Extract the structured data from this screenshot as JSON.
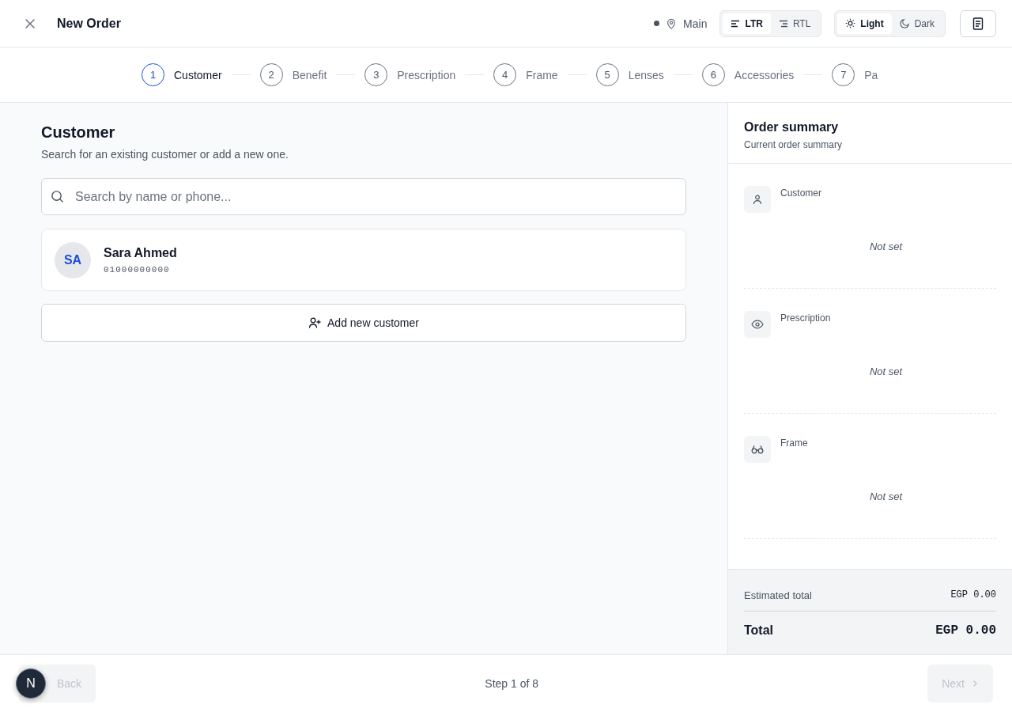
{
  "header": {
    "title": "New Order",
    "location": "Main",
    "direction": [
      {
        "label": "LTR",
        "kind": "ltr",
        "selected": true
      },
      {
        "label": "RTL",
        "kind": "rtl",
        "selected": false
      }
    ],
    "theme": [
      {
        "label": "Light",
        "kind": "light",
        "selected": true
      },
      {
        "label": "Dark",
        "kind": "dark",
        "selected": false
      }
    ]
  },
  "steps": [
    {
      "number": "1",
      "label": "Customer",
      "selected": true
    },
    {
      "number": "2",
      "label": "Benefit",
      "selected": false
    },
    {
      "number": "3",
      "label": "Prescription",
      "selected": false
    },
    {
      "number": "4",
      "label": "Frame",
      "selected": false
    },
    {
      "number": "5",
      "label": "Lenses",
      "selected": false
    },
    {
      "number": "6",
      "label": "Accessories",
      "selected": false
    },
    {
      "number": "7",
      "label": "Pa",
      "selected": false
    }
  ],
  "customer_section": {
    "title": "Customer",
    "subtitle": "Search for an existing customer or add a new one.",
    "search": {
      "placeholder": "Search by name or phone..."
    },
    "customers": [
      {
        "initials": "SA",
        "name": "Sara Ahmed",
        "phone": "01000000000"
      }
    ],
    "add_button": "Add new customer"
  },
  "summary": {
    "title": "Order summary",
    "subtitle": "Current order summary",
    "items": [
      {
        "kind": "person",
        "label": "Customer",
        "value": "Not set"
      },
      {
        "kind": "eye",
        "label": "Prescription",
        "value": "Not set"
      },
      {
        "kind": "glasses",
        "label": "Frame",
        "value": "Not set"
      }
    ],
    "estimated_label": "Estimated total",
    "estimated_value": "EGP 0.00",
    "total_label": "Total",
    "total_value": "EGP 0.00"
  },
  "footer": {
    "back": {
      "label": "Back",
      "disabled": true
    },
    "step_text": "Step 1 of 8",
    "next": {
      "label": "Next",
      "disabled": true
    },
    "dev_badge": "N"
  }
}
